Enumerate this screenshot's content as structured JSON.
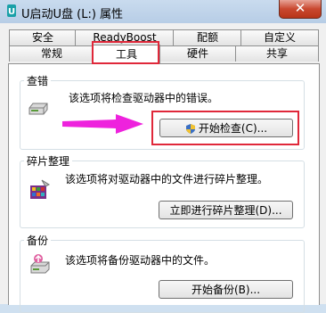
{
  "window": {
    "title": "U启动U盘 (L:) 属性",
    "close_label": "✕"
  },
  "tabs_row1": [
    {
      "label": "安全"
    },
    {
      "label": "ReadyBoost"
    },
    {
      "label": "配额"
    },
    {
      "label": "自定义"
    }
  ],
  "tabs_row2": [
    {
      "label": "常规"
    },
    {
      "label": "工具"
    },
    {
      "label": "硬件"
    },
    {
      "label": "共享"
    }
  ],
  "active_tab": "工具",
  "sections": {
    "error_check": {
      "title": "查错",
      "description": "该选项将检查驱动器中的错误。",
      "button": "开始检查(C)..."
    },
    "defrag": {
      "title": "碎片整理",
      "description": "该选项将对驱动器中的文件进行碎片整理。",
      "button": "立即进行碎片整理(D)..."
    },
    "backup": {
      "title": "备份",
      "description": "该选项将备份驱动器中的文件。",
      "button": "开始备份(B)..."
    }
  },
  "colors": {
    "highlight_box": "#e0283a",
    "arrow": "#ee22dd"
  }
}
